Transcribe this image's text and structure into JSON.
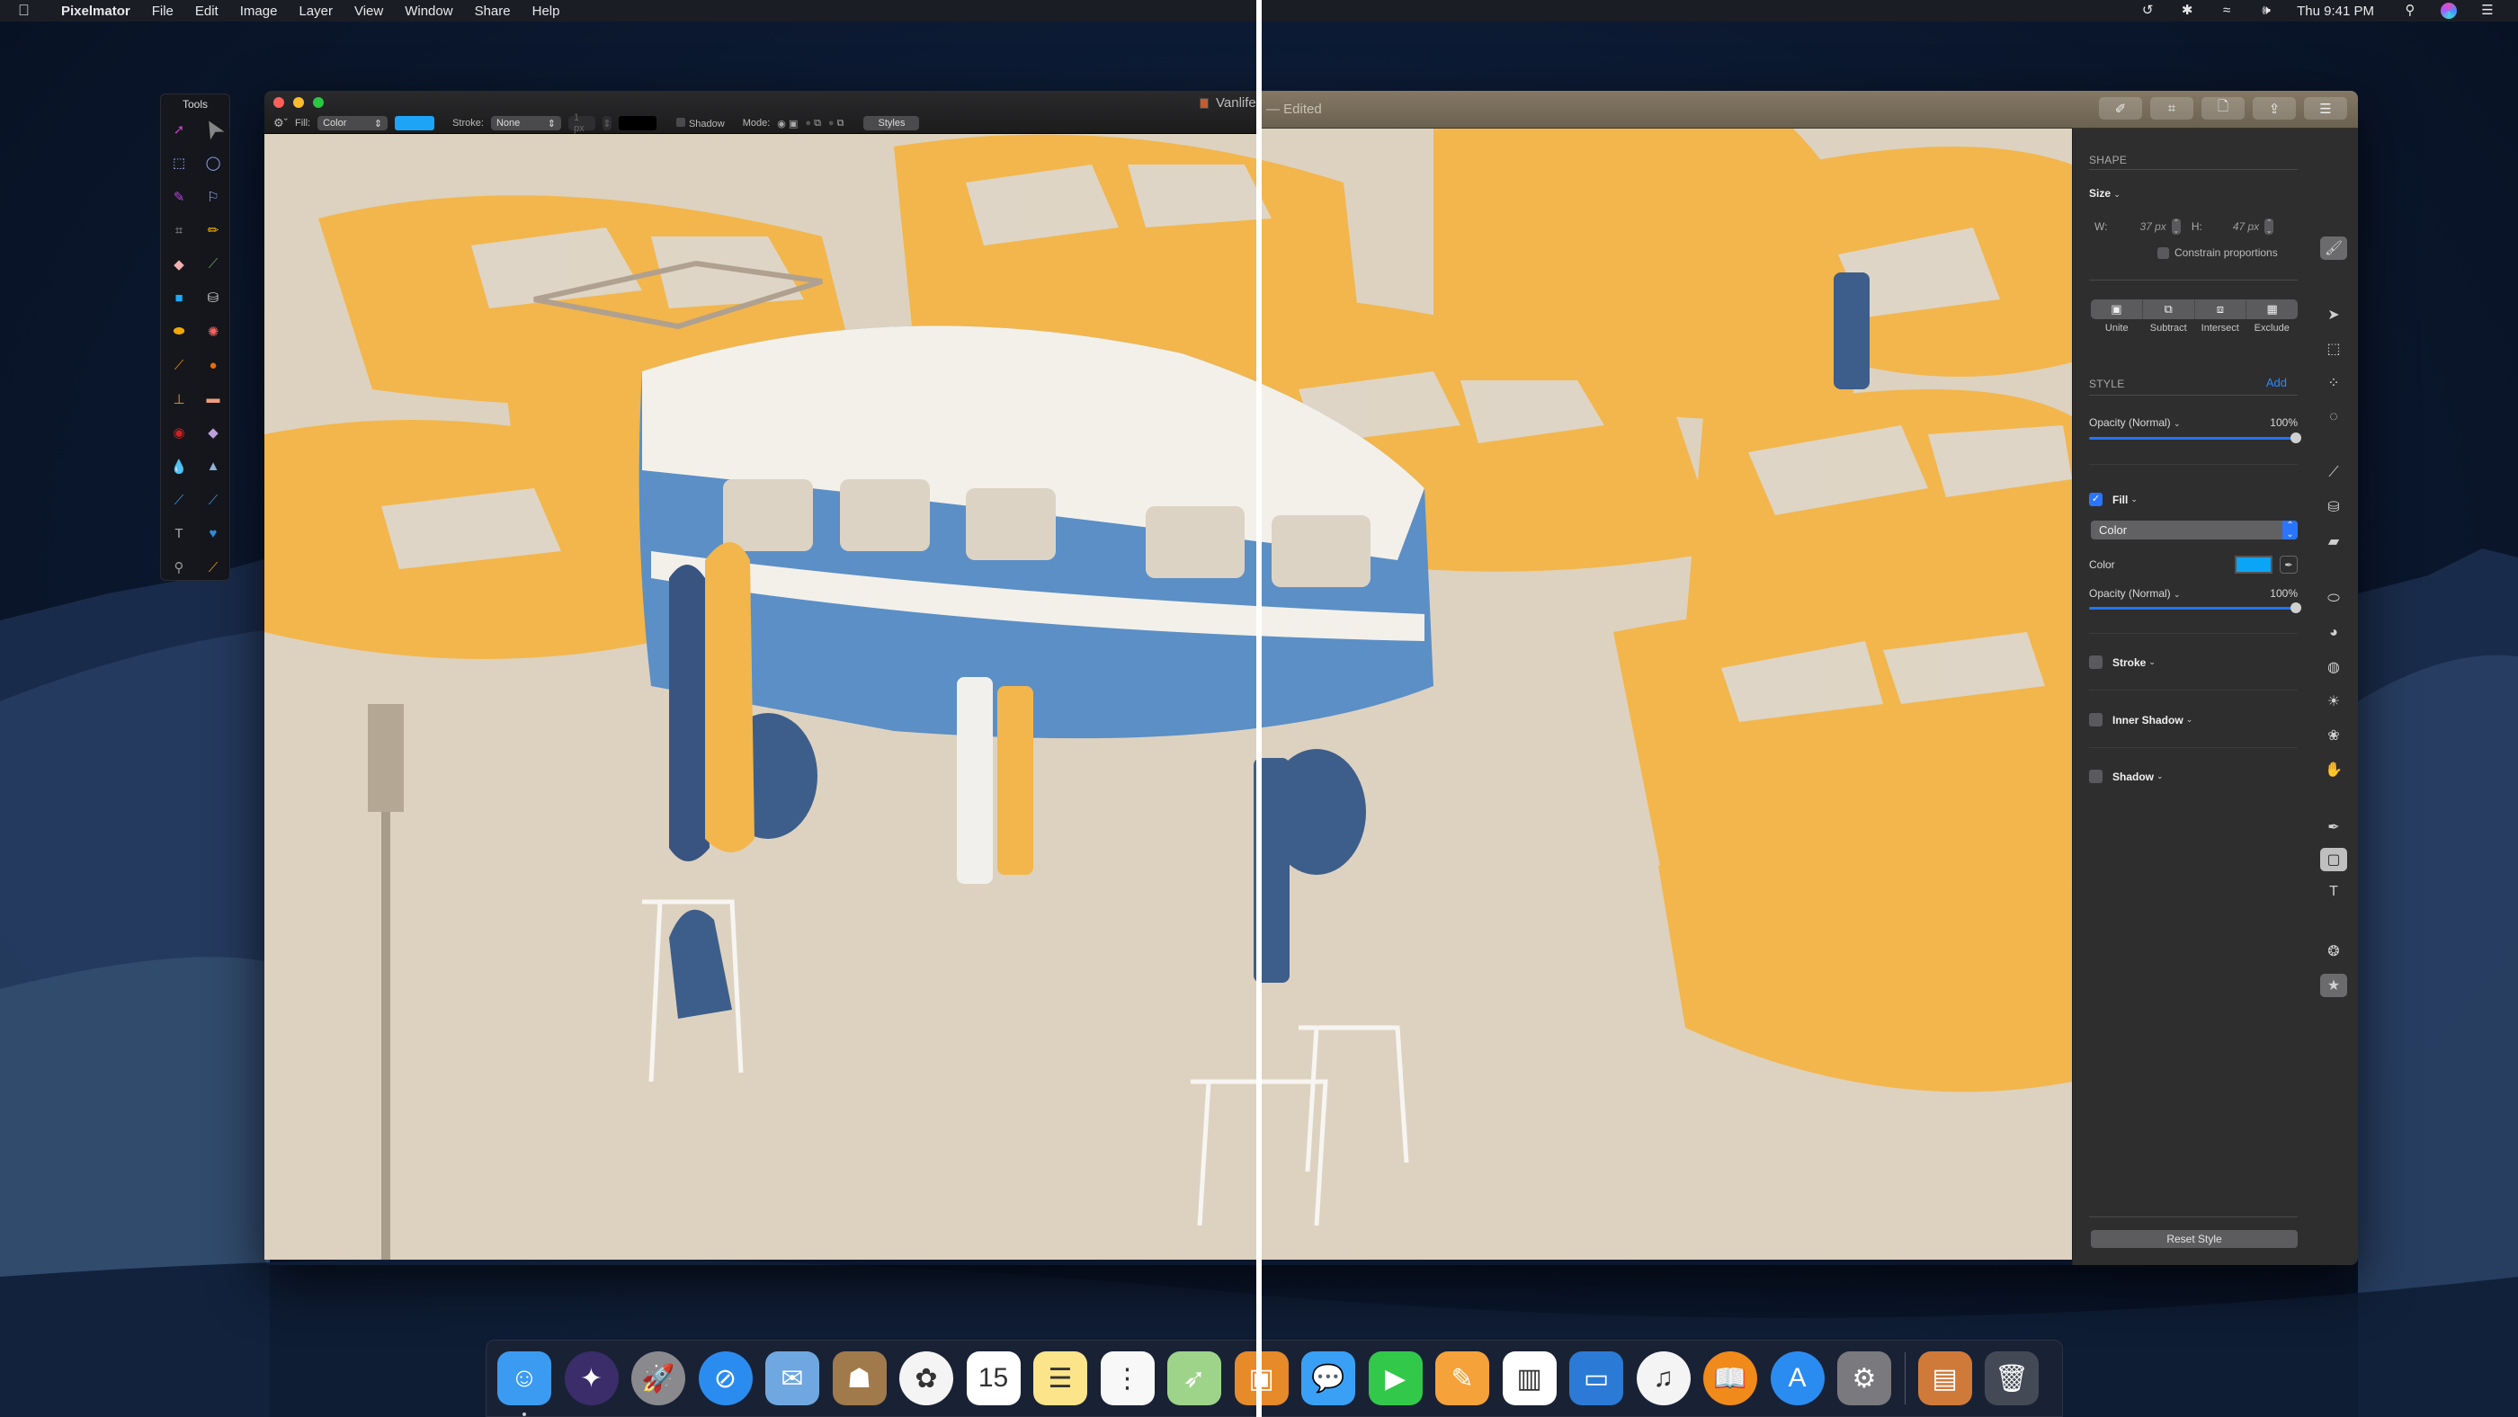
{
  "menubar": {
    "apple_icon": "apple-logo",
    "app_name": "Pixelmator",
    "menus": [
      "File",
      "Edit",
      "Image",
      "Layer",
      "View",
      "Window",
      "Share",
      "Help"
    ],
    "status_icons": [
      "time-machine-icon",
      "bluetooth-icon",
      "wifi-icon",
      "volume-icon"
    ],
    "clock": "Thu 9:41 PM",
    "right_icons": [
      "spotlight-icon",
      "siri-icon",
      "notification-center-icon"
    ]
  },
  "tools_palette": {
    "title": "Tools",
    "tools": [
      {
        "name": "move-tool",
        "glyph": "➚",
        "color": "#c040c0"
      },
      {
        "name": "pointer-cursor",
        "glyph": "➤",
        "color": "#888888"
      },
      {
        "name": "rect-select-tool",
        "glyph": "⬚",
        "color": "#9aa8ff"
      },
      {
        "name": "ellipse-select-tool",
        "glyph": "◯",
        "color": "#9aa8ff"
      },
      {
        "name": "magic-wand-tool",
        "glyph": "✎",
        "color": "#b04ad0"
      },
      {
        "name": "lasso-tool",
        "glyph": "⚐",
        "color": "#a0a8ff"
      },
      {
        "name": "crop-tool",
        "glyph": "⌗",
        "color": "#999999"
      },
      {
        "name": "pencil-tool",
        "glyph": "✏",
        "color": "#f5b800"
      },
      {
        "name": "eraser-tool",
        "glyph": "◆",
        "color": "#f0b0b0"
      },
      {
        "name": "brush-tool",
        "glyph": "⟋",
        "color": "#5ab34a"
      },
      {
        "name": "rectangle-shape-tool",
        "glyph": "■",
        "color": "#1fa8f5"
      },
      {
        "name": "paint-bucket-tool",
        "glyph": "⛁",
        "color": "#dddddd"
      },
      {
        "name": "gradient-tool",
        "glyph": "⬬",
        "color": "#f2a800"
      },
      {
        "name": "color-picker-lollipop-tool",
        "glyph": "✺",
        "color": "#ff6666"
      },
      {
        "name": "smudge-tool",
        "glyph": "⟋",
        "color": "#f28a00"
      },
      {
        "name": "burn-tool",
        "glyph": "●",
        "color": "#f06d00"
      },
      {
        "name": "clone-stamp-tool",
        "glyph": "⊥",
        "color": "#e59a30"
      },
      {
        "name": "repair-tool",
        "glyph": "▬",
        "color": "#f2a07e"
      },
      {
        "name": "red-eye-tool",
        "glyph": "◉",
        "color": "#cc2222"
      },
      {
        "name": "sponge-tool",
        "glyph": "◆",
        "color": "#c0a0e0"
      },
      {
        "name": "blur-tool",
        "glyph": "💧",
        "color": "#7fb5e8"
      },
      {
        "name": "sharpen-tool",
        "glyph": "▲",
        "color": "#8fb5e0"
      },
      {
        "name": "pen-tool",
        "glyph": "⟋",
        "color": "#3d95e6"
      },
      {
        "name": "freeform-pen-tool",
        "glyph": "⟋",
        "color": "#3d95e6"
      },
      {
        "name": "type-tool",
        "glyph": "T",
        "color": "#aaaaaa"
      },
      {
        "name": "custom-shape-tool",
        "glyph": "♥",
        "color": "#2a90e0"
      },
      {
        "name": "zoom-tool",
        "glyph": "⚲",
        "color": "#999999"
      },
      {
        "name": "eyedropper-tool",
        "glyph": "⟋",
        "color": "#f0a000"
      }
    ]
  },
  "window": {
    "old_toolbar": {
      "gear_icon": "gear-icon",
      "fill_label": "Fill:",
      "fill_value": "Color",
      "fill_color": "#1ea4f7",
      "stroke_label": "Stroke:",
      "stroke_value": "None",
      "stroke_width": "1 px",
      "stroke_color": "#000000",
      "shadow_label": "Shadow",
      "mode_label": "Mode:",
      "styles_label": "Styles"
    },
    "title_left": "Vanlife",
    "title_right": "— Edited",
    "title_buttons": [
      {
        "name": "tools-brush-button",
        "glyph": "✐"
      },
      {
        "name": "crop-button",
        "glyph": "⌗"
      },
      {
        "name": "document-button",
        "glyph": "🗋"
      },
      {
        "name": "share-button",
        "glyph": "⇪"
      },
      {
        "name": "adjustments-button",
        "glyph": "☰"
      }
    ]
  },
  "sidebar": {
    "shape_title": "SHAPE",
    "size_label": "Size",
    "width_label": "W:",
    "width_value": "37 px",
    "height_label": "H:",
    "height_value": "47 px",
    "constrain_label": "Constrain proportions",
    "constrain_checked": false,
    "boolean_ops": [
      "Unite",
      "Subtract",
      "Intersect",
      "Exclude"
    ],
    "style_title": "STYLE",
    "add_label": "Add",
    "opacity_label": "Opacity (Normal)",
    "opacity_value": "100%",
    "opacity_fraction": 1.0,
    "fill_label": "Fill",
    "fill_checked": true,
    "fill_type": "Color",
    "color_label": "Color",
    "fill_color": "#0aa5f7",
    "fill_opacity_label": "Opacity (Normal)",
    "fill_opacity_value": "100%",
    "fill_opacity_fraction": 1.0,
    "stroke_label": "Stroke",
    "stroke_checked": false,
    "inner_shadow_label": "Inner Shadow",
    "inner_shadow_checked": false,
    "shadow_label": "Shadow",
    "shadow_checked": false,
    "reset_label": "Reset Style"
  },
  "tool_strip": [
    {
      "name": "style-tool",
      "glyph": "🖌",
      "state": "active"
    },
    {
      "name": "arrange-tool",
      "glyph": "➤",
      "state": ""
    },
    {
      "name": "rect-select-tool",
      "glyph": "⬚",
      "state": ""
    },
    {
      "name": "quick-selection-tool",
      "glyph": "⁘",
      "state": ""
    },
    {
      "name": "color-selection-tool",
      "glyph": "◌",
      "state": ""
    },
    {
      "name": "paint-tool",
      "glyph": "⟋",
      "state": ""
    },
    {
      "name": "paint-bucket-tool",
      "glyph": "⛁",
      "state": ""
    },
    {
      "name": "erase-tool",
      "glyph": "▰",
      "state": ""
    },
    {
      "name": "repair-tool",
      "glyph": "⬭",
      "state": ""
    },
    {
      "name": "clone-tool",
      "glyph": "◕",
      "state": ""
    },
    {
      "name": "sharpen-blur-tool",
      "glyph": "◍",
      "state": ""
    },
    {
      "name": "light-tool",
      "glyph": "☀",
      "state": ""
    },
    {
      "name": "color-adjust-tool",
      "glyph": "❀",
      "state": ""
    },
    {
      "name": "warp-tool",
      "glyph": "✋",
      "state": ""
    },
    {
      "name": "pen-tool",
      "glyph": "✒",
      "state": ""
    },
    {
      "name": "shape-tool",
      "glyph": "▢",
      "state": "sel"
    },
    {
      "name": "type-tool",
      "glyph": "T",
      "state": ""
    },
    {
      "name": "color-picker-tool",
      "glyph": "❂",
      "state": ""
    },
    {
      "name": "effects-tool",
      "glyph": "★",
      "state": "active"
    }
  ],
  "dock": {
    "apps": [
      {
        "name": "finder",
        "glyph": "☺",
        "bg": "#3b9bf0",
        "running": true
      },
      {
        "name": "siri",
        "glyph": "✦",
        "bg": "#3a2d6a",
        "running": false
      },
      {
        "name": "launchpad",
        "glyph": "🚀",
        "bg": "#8a8a8e",
        "running": false
      },
      {
        "name": "safari",
        "glyph": "⊘",
        "bg": "#2b8cf0",
        "running": false
      },
      {
        "name": "mail",
        "glyph": "✉",
        "bg": "#6fa8e0",
        "running": false
      },
      {
        "name": "contacts",
        "glyph": "☗",
        "bg": "#a07a4a",
        "running": false
      },
      {
        "name": "photos",
        "glyph": "✿",
        "bg": "#f4f4f4",
        "running": false
      },
      {
        "name": "calendar",
        "glyph": "15",
        "bg": "#ffffff",
        "running": false
      },
      {
        "name": "notes",
        "glyph": "☰",
        "bg": "#fbe48a",
        "running": false
      },
      {
        "name": "reminders",
        "glyph": "⋮",
        "bg": "#f8f8f8",
        "running": false
      },
      {
        "name": "maps",
        "glyph": "➶",
        "bg": "#9ed48a",
        "running": false
      },
      {
        "name": "photo-booth",
        "glyph": "▣",
        "bg": "#e68a2a",
        "running": false
      },
      {
        "name": "messages",
        "glyph": "💬",
        "bg": "#3aa0f5",
        "running": false
      },
      {
        "name": "facetime",
        "glyph": "▶",
        "bg": "#32c84a",
        "running": false
      },
      {
        "name": "pages",
        "glyph": "✎",
        "bg": "#f5a23a",
        "running": false
      },
      {
        "name": "numbers",
        "glyph": "▥",
        "bg": "#ffffff",
        "running": false
      },
      {
        "name": "keynote",
        "glyph": "▭",
        "bg": "#2a7ad6",
        "running": false
      },
      {
        "name": "itunes",
        "glyph": "♫",
        "bg": "#f4f4f4",
        "running": false
      },
      {
        "name": "ibooks",
        "glyph": "📖",
        "bg": "#f08a1a",
        "running": false
      },
      {
        "name": "app-store",
        "glyph": "A",
        "bg": "#2a8cf0",
        "running": false
      },
      {
        "name": "system-preferences",
        "glyph": "⚙",
        "bg": "#7a7a7e",
        "running": false
      }
    ],
    "stack": {
      "name": "downloads-stack",
      "glyph": "▤",
      "bg": "#d07a3a"
    },
    "trash": {
      "name": "trash",
      "glyph": "🗑",
      "bg": "#444a55"
    }
  }
}
